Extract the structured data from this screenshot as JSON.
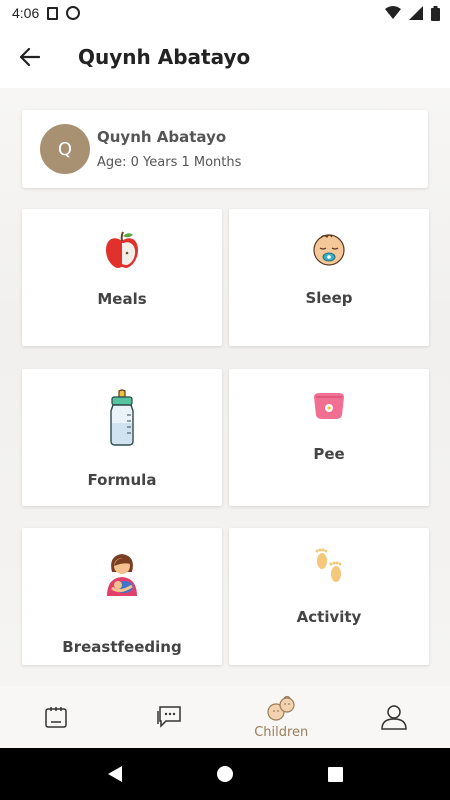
{
  "status_bar": {
    "time": "4:06"
  },
  "header": {
    "title": "Quynh Abatayo"
  },
  "profile": {
    "initial": "Q",
    "name": "Quynh Abatayo",
    "age": "Age: 0 Years 1 Months",
    "avatar_color": "#a89173"
  },
  "tiles": [
    {
      "label": "Meals",
      "icon": "apple-icon"
    },
    {
      "label": "Sleep",
      "icon": "baby-face-icon"
    },
    {
      "label": "Formula",
      "icon": "baby-bottle-icon"
    },
    {
      "label": "Pee",
      "icon": "potty-icon"
    },
    {
      "label": "Breastfeeding",
      "icon": "breastfeeding-icon"
    },
    {
      "label": "Activity",
      "icon": "footprints-icon"
    }
  ],
  "bottom_nav": {
    "items": [
      {
        "icon": "calendar-icon"
      },
      {
        "icon": "chat-icon"
      },
      {
        "icon": "children-icon",
        "label": "Children",
        "active": true
      },
      {
        "icon": "profile-icon"
      }
    ],
    "accent": "#9a7d59"
  }
}
